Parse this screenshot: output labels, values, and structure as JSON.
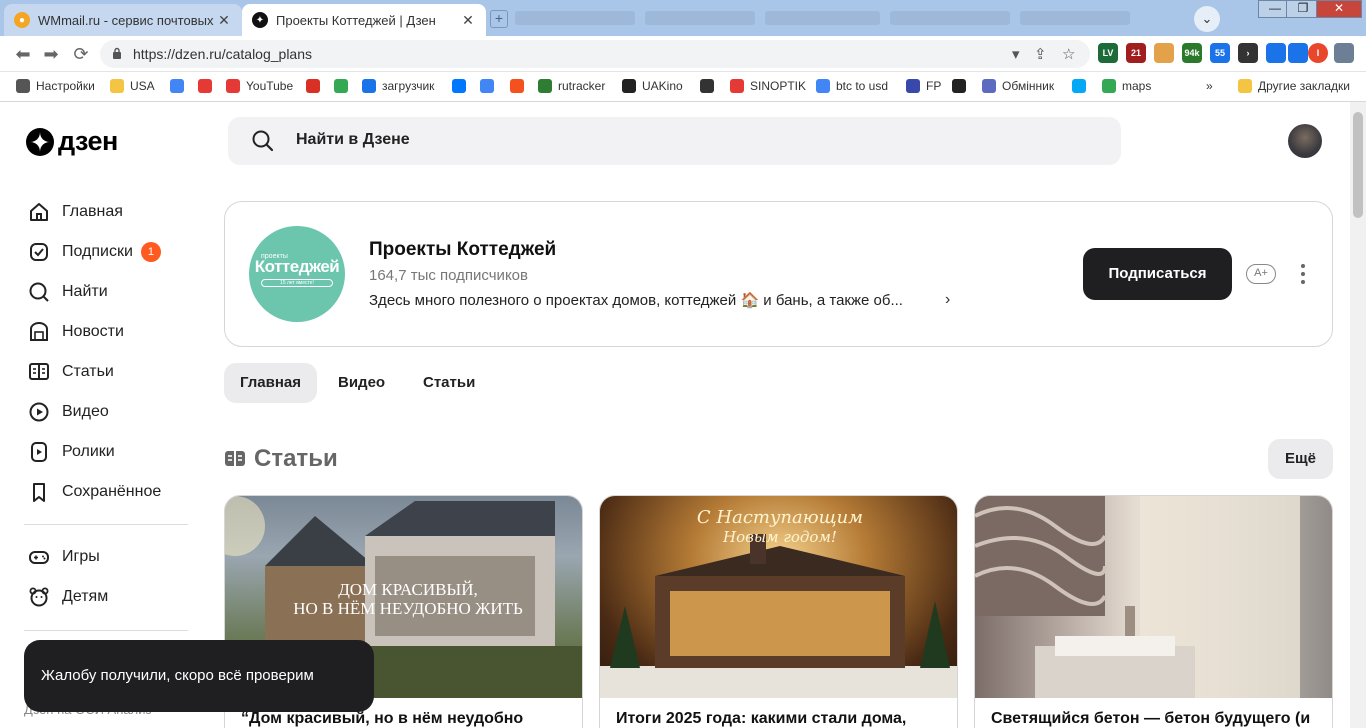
{
  "browser": {
    "tabs": [
      {
        "title": "WMmail.ru - сервис почтовых рас",
        "active": false
      },
      {
        "title": "Проекты Коттеджей | Дзен",
        "active": true
      }
    ],
    "close_glyph": "✕",
    "new_tab_glyph": "+",
    "window_controls": {
      "minimize": "—",
      "maximize": "❐",
      "close": "✕"
    },
    "profile_glyph": "⌄",
    "url": "https://dzen.ru/catalog_plans",
    "extensions": [
      {
        "label": "LV",
        "color": "#1e6b3a"
      },
      {
        "label": "21",
        "color": "#a21d1d"
      },
      {
        "label": "",
        "color": "#e3a24a"
      },
      {
        "label": "94k",
        "color": "#2b7a2b"
      },
      {
        "label": "55",
        "color": "#1a73e8"
      },
      {
        "label": "›",
        "color": "#333333"
      },
      {
        "label": "",
        "color": "#1a73e8"
      },
      {
        "label": "",
        "color": "#1a73e8"
      },
      {
        "label": "I",
        "color": "#e8472b"
      },
      {
        "label": "",
        "color": "#6d7f95"
      }
    ],
    "bookmarks": [
      {
        "label": "Настройки",
        "icon": "gear-icon",
        "color": "#555555"
      },
      {
        "label": "USA",
        "icon": "folder-icon",
        "color": "#f4c542"
      },
      {
        "label": "",
        "icon": "google-icon",
        "color": "#4285f4"
      },
      {
        "label": "",
        "icon": "yandex-icon",
        "color": "#e53935"
      },
      {
        "label": "YouTube",
        "icon": "youtube-icon",
        "color": "#e53935"
      },
      {
        "label": "",
        "icon": "gmail-icon",
        "color": "#d93025"
      },
      {
        "label": "",
        "icon": "drive-icon",
        "color": "#34a853"
      },
      {
        "label": "загрузчик",
        "icon": "link-icon",
        "color": "#1a73e8"
      },
      {
        "label": "",
        "icon": "vk-icon",
        "color": "#0077ff"
      },
      {
        "label": "",
        "icon": "translate-icon",
        "color": "#4285f4"
      },
      {
        "label": "",
        "icon": "f-icon",
        "color": "#f4511e"
      },
      {
        "label": "rutracker",
        "icon": "rutracker-icon",
        "color": "#2e7d32"
      },
      {
        "label": "UAKino",
        "icon": "uakino-icon",
        "color": "#222222"
      },
      {
        "label": "",
        "icon": "chess-icon",
        "color": "#333333"
      },
      {
        "label": "SINOPTIK",
        "icon": "thermometer-icon",
        "color": "#e53935"
      },
      {
        "label": "btc to usd",
        "icon": "google-icon",
        "color": "#4285f4"
      },
      {
        "label": "FP",
        "icon": "fp-icon",
        "color": "#3949ab"
      },
      {
        "label": "",
        "icon": "bc-icon",
        "color": "#222222"
      },
      {
        "label": "Обмінник",
        "icon": "exchange-icon",
        "color": "#5c6bc0"
      },
      {
        "label": "",
        "icon": "snowflake-icon",
        "color": "#03a9f4"
      },
      {
        "label": "maps",
        "icon": "maps-icon",
        "color": "#34a853"
      }
    ],
    "bookmarks_overflow": "»",
    "other_bookmarks": "Другие закладки"
  },
  "header": {
    "logo_text": "дзен",
    "search_placeholder": "Найти в Дзене"
  },
  "sidebar": {
    "items": [
      {
        "label": "Главная",
        "icon": "home-icon"
      },
      {
        "label": "Подписки",
        "icon": "subscriptions-icon",
        "badge": "1"
      },
      {
        "label": "Найти",
        "icon": "search-icon"
      },
      {
        "label": "Новости",
        "icon": "news-icon"
      },
      {
        "label": "Статьи",
        "icon": "articles-icon"
      },
      {
        "label": "Видео",
        "icon": "video-icon"
      },
      {
        "label": "Ролики",
        "icon": "shorts-icon"
      },
      {
        "label": "Сохранённое",
        "icon": "bookmark-icon"
      }
    ],
    "items2": [
      {
        "label": "Игры",
        "icon": "gamepad-icon"
      },
      {
        "label": "Детям",
        "icon": "kids-icon"
      }
    ],
    "footer_text": "Дзен на ОСИ Анализ"
  },
  "channel": {
    "name": "Проекты Коттеджей",
    "subscribers": "164,7 тыс подписчиков",
    "description": "Здесь много полезного о проектах домов, коттеджей 🏠 и бань, а также об...",
    "more_glyph": "›",
    "subscribe_label": "Подписаться",
    "font_size_label": "A+",
    "logo": {
      "top": "проекты",
      "main": "Коттеджей",
      "bottom": "15 лет вместе!"
    },
    "logo_color": "#6bc6ad"
  },
  "tabs": [
    {
      "label": "Главная",
      "selected": true
    },
    {
      "label": "Видео",
      "selected": false
    },
    {
      "label": "Статьи",
      "selected": false
    }
  ],
  "section": {
    "title": "Статьи",
    "more_label": "Ещё"
  },
  "cards": [
    {
      "title": "“Дом красивый, но в нём неудобно",
      "overlay": "ДОМ КРАСИВЫЙ,\nНО В НЁМ НЕУДОБНО ЖИТЬ"
    },
    {
      "title": "Итоги 2025 года: какими стали дома,",
      "overlay": "С Наступающим\nНовым годом!"
    },
    {
      "title": "Светящийся бетон — бетон будущего (и",
      "overlay": ""
    }
  ],
  "toast": {
    "text": "Жалобу получили, скоро всё проверим"
  }
}
